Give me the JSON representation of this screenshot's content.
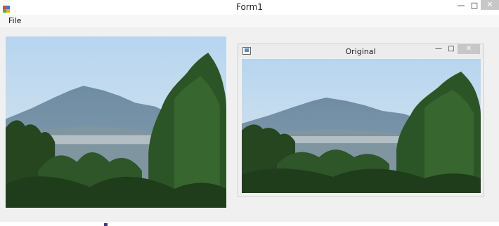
{
  "window": {
    "title": "Form1",
    "icon": "winforms-app-icon",
    "min_glyph": "—",
    "max_glyph": "□",
    "close_glyph": "✕"
  },
  "menu": {
    "items": [
      {
        "label": "File"
      }
    ]
  },
  "pictures": {
    "left": {
      "content": "landscape-mountain-photo"
    },
    "right": {
      "content": "landscape-mountain-photo"
    }
  },
  "child_window": {
    "title": "Original",
    "icon": "form-icon",
    "min_glyph": "—",
    "max_glyph": "□",
    "close_glyph": "✕"
  },
  "colors": {
    "window_bg": "#f0f0f0",
    "titlebar_bg": "#ffffff",
    "close_button_bg": "#c7c7c7",
    "sky_top": "#b9d6ee",
    "sky_bottom": "#d8e6ee",
    "mountain": "#6f8fa6",
    "forest": "#2f5b2a"
  }
}
